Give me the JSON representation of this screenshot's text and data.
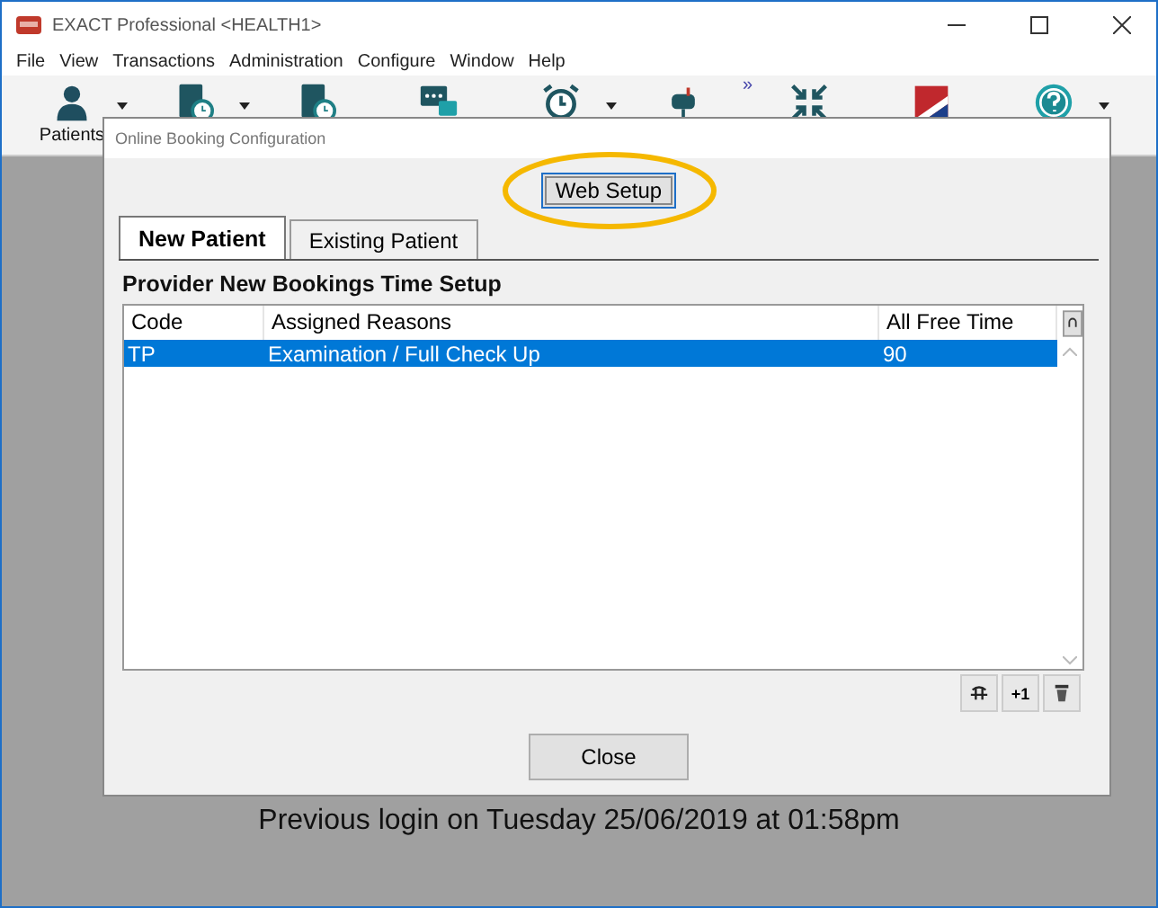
{
  "window": {
    "title": "EXACT Professional <HEALTH1>"
  },
  "menu": [
    "File",
    "View",
    "Transactions",
    "Administration",
    "Configure",
    "Window",
    "Help"
  ],
  "toolbar": {
    "overflow": "»",
    "items": [
      {
        "kind": "person",
        "label": "Patients",
        "dropdown": true
      },
      {
        "kind": "book-clock",
        "dropdown": true
      },
      {
        "kind": "book-clock",
        "dropdown": false
      },
      {
        "kind": "chat",
        "dropdown": false
      },
      {
        "kind": "alarm",
        "dropdown": true
      },
      {
        "kind": "mailbox",
        "dropdown": false
      },
      {
        "kind": "arrows",
        "dropdown": false
      },
      {
        "kind": "flag",
        "dropdown": false
      },
      {
        "kind": "help",
        "dropdown": true
      }
    ]
  },
  "dialog": {
    "title": "Online Booking Configuration",
    "web_setup_button": "Web Setup",
    "tabs": [
      {
        "label": "New Patient",
        "selected": true
      },
      {
        "label": "Existing Patient",
        "selected": false
      }
    ],
    "section_title": "Provider New Bookings Time Setup",
    "table": {
      "columns": [
        "Code",
        "Assigned Reasons",
        "All Free Time"
      ],
      "rows": [
        {
          "cells": [
            "TP",
            "Examination / Full Check Up",
            "90"
          ],
          "selected": true
        }
      ]
    },
    "action_buttons": [
      {
        "kind": "edit"
      },
      {
        "kind": "text",
        "label": "+1"
      },
      {
        "kind": "delete"
      }
    ],
    "close_button": "Close"
  },
  "status_message": "Previous login on Tuesday 25/06/2019 at 01:58pm"
}
